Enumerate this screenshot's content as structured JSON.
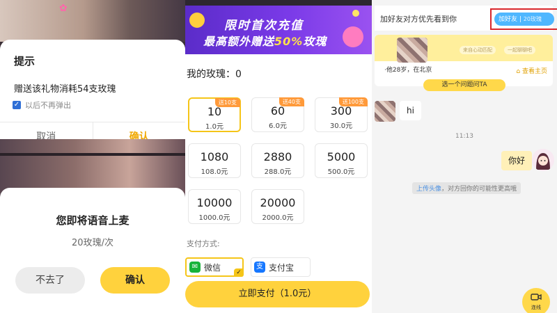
{
  "left": {
    "gift_dialog": {
      "title": "提示",
      "message": "赠送该礼物消耗54支玫瑰",
      "checkbox_label": "以后不再弹出",
      "checkbox_checked": true,
      "cancel_label": "取消",
      "confirm_label": "确认"
    },
    "voice_dialog": {
      "title": "您即将语音上麦",
      "subtitle": "20玫瑰/次",
      "cancel_label": "不去了",
      "confirm_label": "确认"
    }
  },
  "middle": {
    "banner": {
      "line1": "限时首次充值",
      "line2_prefix": "最高额外赠送",
      "line2_highlight": "50%",
      "line2_suffix": "玫瑰"
    },
    "balance_label": "我的玫瑰：0",
    "packages": [
      {
        "amount": "10",
        "price": "1.0元",
        "bonus": "送10支",
        "selected": true
      },
      {
        "amount": "60",
        "price": "6.0元",
        "bonus": "送40支",
        "selected": false
      },
      {
        "amount": "300",
        "price": "30.0元",
        "bonus": "送100支",
        "selected": false
      },
      {
        "amount": "1080",
        "price": "108.0元",
        "bonus": "",
        "selected": false
      },
      {
        "amount": "2880",
        "price": "288.0元",
        "bonus": "",
        "selected": false
      },
      {
        "amount": "5000",
        "price": "500.0元",
        "bonus": "",
        "selected": false
      },
      {
        "amount": "10000",
        "price": "1000.0元",
        "bonus": "",
        "selected": false
      },
      {
        "amount": "20000",
        "price": "2000.0元",
        "bonus": "",
        "selected": false
      }
    ],
    "payment_label": "支付方式:",
    "payment_methods": [
      {
        "label": "微信",
        "icon": "wechat-icon",
        "selected": true
      },
      {
        "label": "支付宝",
        "icon": "alipay-icon",
        "selected": false
      }
    ],
    "pay_button": "立即支付（1.0元）"
  },
  "right": {
    "header_text": "加好友对方优先看到你",
    "add_friend_label": "加好友",
    "add_friend_cost": "20玫瑰",
    "profile_card": {
      "info": "·他28岁，在北京",
      "tag1": "来自心动匹配",
      "tag2": "一起聊聊吧",
      "home_link": "查看主页"
    },
    "ask_button": "选一个问题问TA",
    "messages": [
      {
        "from": "other",
        "text": "hi"
      },
      {
        "from": "me",
        "text": "你好"
      }
    ],
    "timestamp": "11:13",
    "tip_link": "上传头像",
    "tip_text": "，对方回你的可能性更高哦",
    "video_label": "连线"
  },
  "colors": {
    "accent_yellow": "#ffd23d",
    "confirm_text": "#f0a800",
    "bonus_tag": "#ff9a3a",
    "highlight_box": "#d9262b",
    "add_friend_blue": "#4fb7ff"
  }
}
